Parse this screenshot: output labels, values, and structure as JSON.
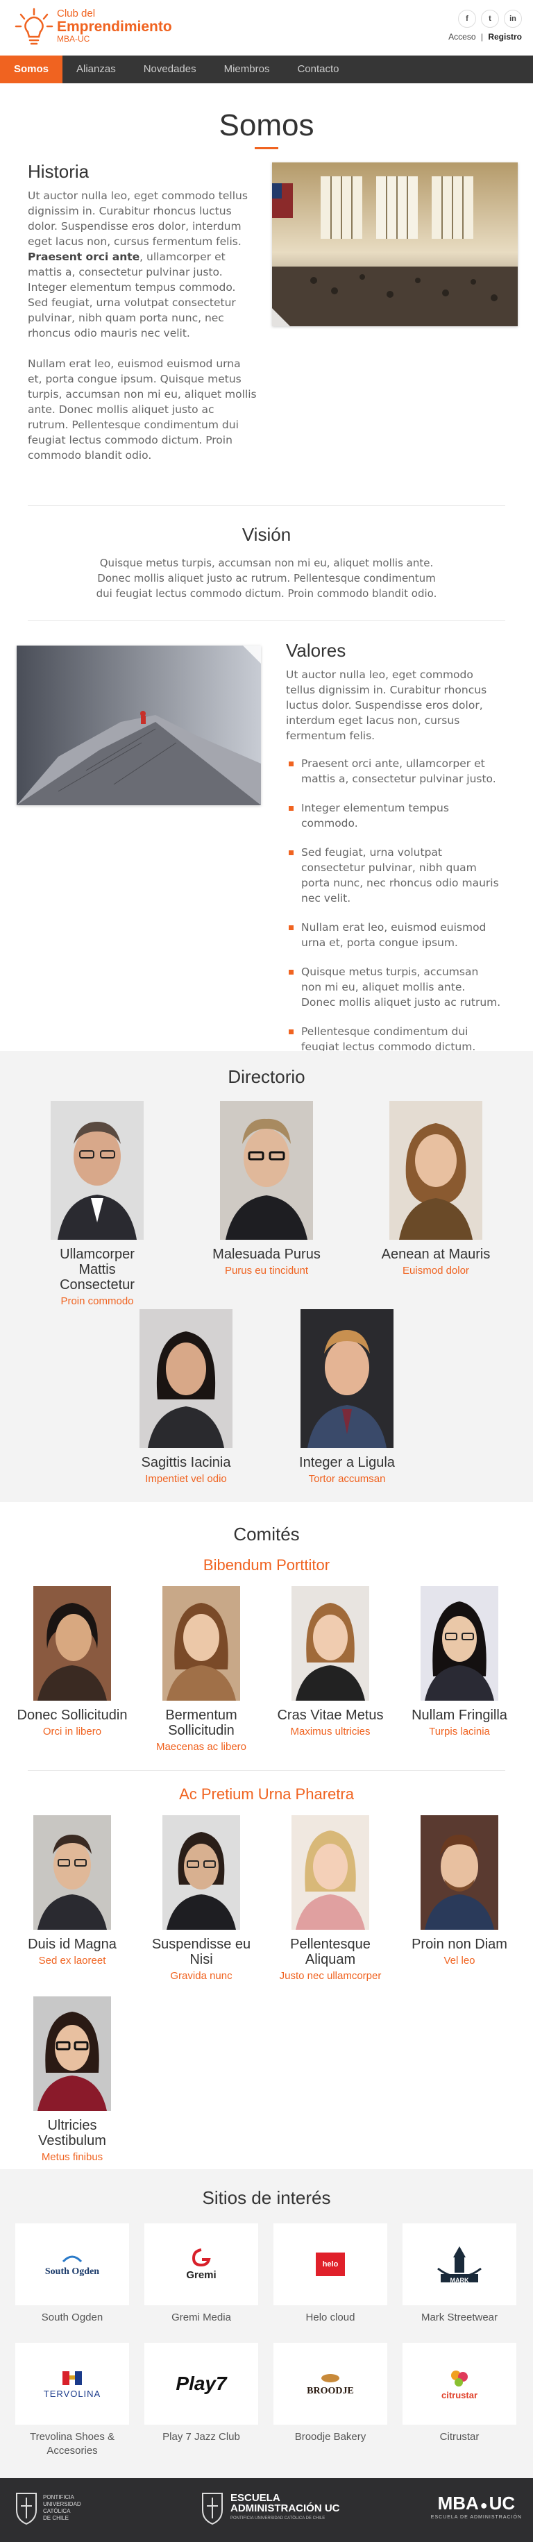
{
  "brand": {
    "line1": "Club del",
    "line2": "Emprendimiento",
    "line3": "MBA-UC",
    "accent": "#f06320"
  },
  "social": [
    "f",
    "t",
    "in"
  ],
  "auth": {
    "login": "Acceso",
    "sep": "|",
    "register": "Registro"
  },
  "nav": [
    "Somos",
    "Alianzas",
    "Novedades",
    "Miembros",
    "Contacto"
  ],
  "page_title": "Somos",
  "historia": {
    "title": "Historia",
    "p1a": "Ut auctor nulla leo, eget commodo tellus dignissim in. Curabitur rhoncus luctus dolor. Suspendisse eros dolor, interdum eget lacus non, cursus fermentum felis. ",
    "p1b": "Praesent orci ante",
    "p1c": ", ullamcorper et mattis a, consectetur pulvinar justo. Integer elementum tempus commodo. Sed feugiat, urna volutpat consectetur pulvinar, nibh quam porta nunc, nec rhoncus odio mauris nec velit.",
    "p2": "Nullam erat leo, euismod euismod urna et, porta congue ipsum. Quisque metus turpis, accumsan non mi eu, aliquet mollis ante. Donec mollis aliquet justo ac rutrum. Pellentesque condimentum dui feugiat lectus commodo dictum. Proin commodo blandit odio."
  },
  "vision": {
    "title": "Visión",
    "text": "Quisque metus turpis, accumsan non mi eu, aliquet mollis ante. Donec mollis aliquet justo ac rutrum. Pellentesque condimentum dui feugiat lectus commodo dictum. Proin commodo blandit odio."
  },
  "valores": {
    "title": "Valores",
    "intro": "Ut auctor nulla leo, eget commodo tellus dignissim in. Curabitur rhoncus luctus dolor. Suspendisse eros dolor, interdum eget lacus non, cursus fermentum felis.",
    "items": [
      "Praesent orci ante, ullamcorper et mattis a, consectetur pulvinar justo.",
      "Integer elementum tempus commodo.",
      "Sed feugiat, urna volutpat consectetur pulvinar, nibh quam porta nunc, nec rhoncus odio mauris nec velit.",
      "Nullam erat leo, euismod euismod urna et, porta congue ipsum.",
      "Quisque metus turpis, accumsan non mi eu, aliquet mollis ante. Donec mollis aliquet justo ac rutrum.",
      "Pellentesque condimentum dui feugiat lectus commodo dictum. Proin commodo blandit odio."
    ]
  },
  "directorio": {
    "title": "Directorio",
    "people": [
      {
        "name": "Ullamcorper Mattis Consectetur",
        "role": "Proin commodo"
      },
      {
        "name": "Malesuada Purus",
        "role": "Purus eu tincidunt"
      },
      {
        "name": "Aenean at Mauris",
        "role": "Euismod dolor"
      },
      {
        "name": "Sagittis Iacinia",
        "role": "Impentiet vel odio"
      },
      {
        "name": "Integer a Ligula",
        "role": "Tortor accumsan"
      }
    ]
  },
  "comites": {
    "title": "Comités",
    "groups": [
      {
        "title": "Bibendum Porttitor",
        "people": [
          {
            "name": "Donec Sollicitudin",
            "role": "Orci in libero"
          },
          {
            "name": "Bermentum Sollicitudin",
            "role": "Maecenas ac libero"
          },
          {
            "name": "Cras Vitae Metus",
            "role": "Maximus ultricies"
          },
          {
            "name": "Nullam Fringilla",
            "role": "Turpis lacinia"
          }
        ]
      },
      {
        "title": "Ac Pretium Urna Pharetra",
        "people": [
          {
            "name": "Duis id Magna",
            "role": "Sed ex laoreet"
          },
          {
            "name": "Suspendisse eu Nisi",
            "role": "Gravida nunc"
          },
          {
            "name": "Pellentesque Aliquam",
            "role": "Justo nec ullamcorper"
          },
          {
            "name": "Proin non Diam",
            "role": "Vel leo"
          },
          {
            "name": "Ultricies Vestibulum",
            "role": "Metus finibus"
          }
        ]
      }
    ]
  },
  "sitios": {
    "title": "Sitios de interés",
    "items": [
      {
        "label": "South Ogden",
        "logo": "South Ogden"
      },
      {
        "label": "Gremi Media",
        "logo": "Gremi"
      },
      {
        "label": "Helo cloud",
        "logo": "helo"
      },
      {
        "label": "Mark Streetwear",
        "logo": "MARK"
      },
      {
        "label": "Trevolina Shoes & Accesories",
        "logo": "TERVOLINA"
      },
      {
        "label": "Play 7 Jazz Club",
        "logo": "Play7"
      },
      {
        "label": "Broodje Bakery",
        "logo": "BROODJE"
      },
      {
        "label": "Citrustar",
        "logo": "citrustar"
      }
    ]
  },
  "footer": {
    "logo1a": "PONTIFICIA",
    "logo1b": "UNIVERSIDAD",
    "logo1c": "CATÓLICA",
    "logo1d": "DE CHILE",
    "logo2a": "ESCUELA",
    "logo2b": "ADMINISTRACIÓN UC",
    "logo2c": "PONTIFICIA UNIVERSIDAD CATÓLICA DE CHILE",
    "logo3a": "MBA",
    "logo3b": "UC",
    "logo3c": "ESCUELA DE ADMINISTRACIÓN"
  }
}
